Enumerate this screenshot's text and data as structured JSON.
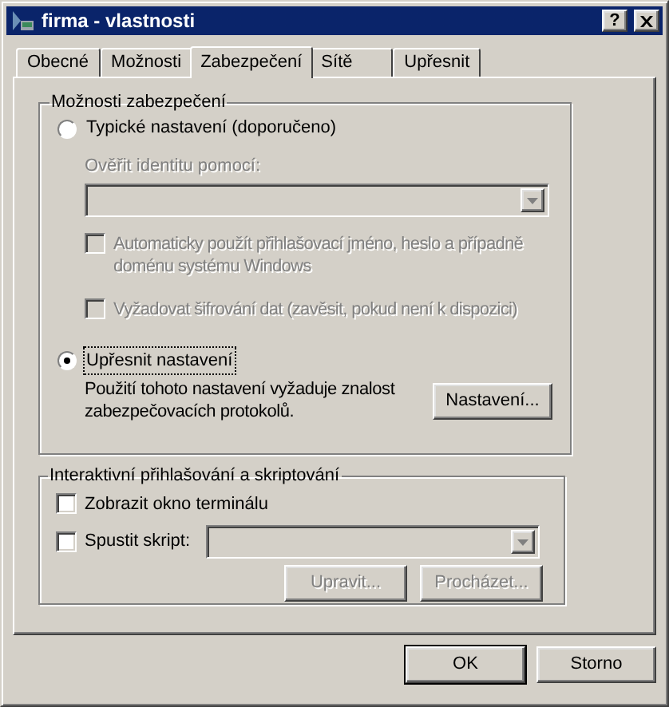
{
  "window": {
    "title": "firma - vlastnosti",
    "help_button": "?"
  },
  "tabs": [
    {
      "label": "Obecné",
      "selected": false
    },
    {
      "label": "Možnosti",
      "selected": false
    },
    {
      "label": "Zabezpečení",
      "selected": true
    },
    {
      "label": "Sítě",
      "selected": false
    },
    {
      "label": "Upřesnit",
      "selected": false
    }
  ],
  "security": {
    "title": "Možnosti zabezpečení",
    "options": [
      {
        "label": "Typické nastavení (doporučeno)",
        "selected": false
      },
      {
        "label": "Upřesnit nastavení",
        "selected": true
      }
    ],
    "verify_label": "Ověřit identitu pomocí:",
    "checkboxes": [
      {
        "label": "Automaticky použít přihlašovací jméno, heslo a případně doménu systému Windows",
        "checked": false
      },
      {
        "label": "Vyžadovat šifrování dat (zavěsit, pokud není k dispozici)",
        "checked": false
      }
    ],
    "note": "Použití tohoto nastavení vyžaduje znalost zabezpečovacích protokolů.",
    "settings_button": "Nastavení..."
  },
  "interactive": {
    "title": "Interaktivní přihlašování a skriptování",
    "terminal": {
      "label": "Zobrazit okno terminálu",
      "checked": false
    },
    "script": {
      "label": "Spustit skript:",
      "checked": false
    },
    "edit_button": "Upravit...",
    "browse_button": "Procházet..."
  },
  "buttons": [
    "OK",
    "Storno"
  ]
}
